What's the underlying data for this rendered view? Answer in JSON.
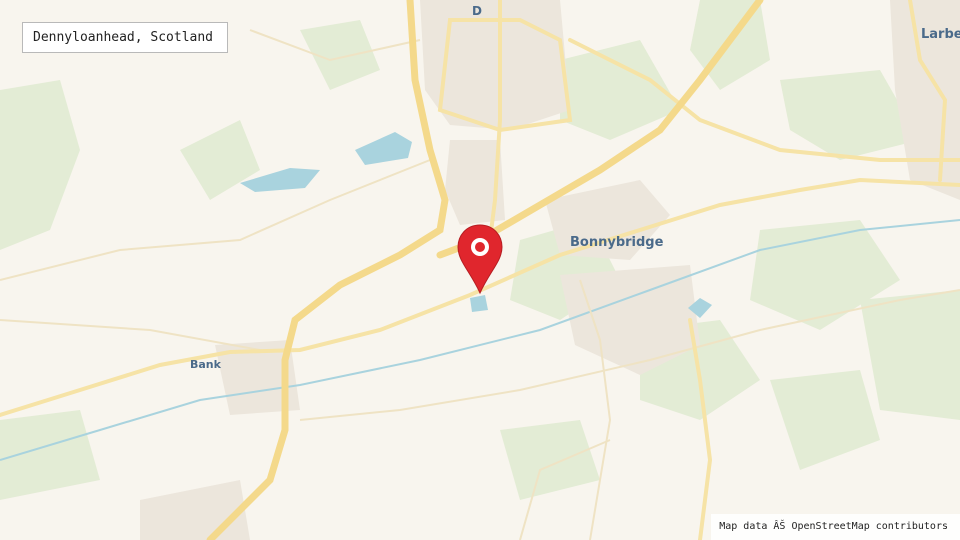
{
  "location": {
    "label": "Dennyloanhead, Scotland"
  },
  "places": {
    "bonnybridge": "Bonnybridge",
    "larbert": "Larbert",
    "banknock": "Bank",
    "denny": "D"
  },
  "attribution": "Map data ÂŠ OpenStreetMap contributors",
  "colors": {
    "land": "#f8f5ee",
    "green": "#e3ecd5",
    "water": "#a9d3de",
    "motorway": "#f4d98b",
    "road_major": "#f6e3a6",
    "urban": "#ece6dc",
    "marker": "#e0262d"
  }
}
